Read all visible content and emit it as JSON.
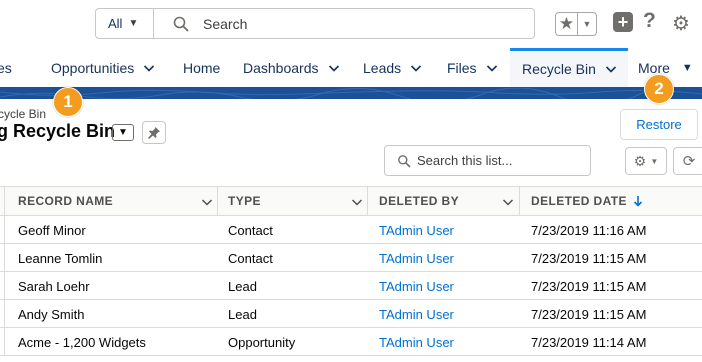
{
  "header": {
    "search_scope": "All",
    "search_placeholder": "Search"
  },
  "nav": {
    "partial_app_label": "es",
    "items": [
      {
        "label": "Opportunities",
        "has_menu": true
      },
      {
        "label": "Home",
        "has_menu": false
      },
      {
        "label": "Dashboards",
        "has_menu": true
      },
      {
        "label": "Leads",
        "has_menu": true
      },
      {
        "label": "Files",
        "has_menu": true
      },
      {
        "label": "Recycle Bin",
        "has_menu": true,
        "active": true
      },
      {
        "label": "More",
        "has_menu": true
      }
    ]
  },
  "callouts": [
    "1",
    "2"
  ],
  "list": {
    "breadcrumb": "cycle Bin",
    "title": "g Recycle Bin",
    "restore_label": "Restore",
    "search_placeholder": "Search this list..."
  },
  "table": {
    "columns": [
      "RECORD NAME",
      "TYPE",
      "DELETED BY",
      "DELETED DATE"
    ],
    "sorted_column": "DELETED DATE",
    "rows": [
      {
        "record": "Geoff Minor",
        "type": "Contact",
        "deleted_by": "TAdmin User",
        "date": "7/23/2019 11:16 AM"
      },
      {
        "record": "Leanne Tomlin",
        "type": "Contact",
        "deleted_by": "TAdmin User",
        "date": "7/23/2019 11:15 AM"
      },
      {
        "record": "Sarah Loehr",
        "type": "Lead",
        "deleted_by": "TAdmin User",
        "date": "7/23/2019 11:15 AM"
      },
      {
        "record": "Andy Smith",
        "type": "Lead",
        "deleted_by": "TAdmin User",
        "date": "7/23/2019 11:15 AM"
      },
      {
        "record": "Acme - 1,200 Widgets",
        "type": "Opportunity",
        "deleted_by": "TAdmin User",
        "date": "7/23/2019 11:14 AM"
      }
    ]
  },
  "icons": [
    "search-icon",
    "star-icon",
    "plus-icon",
    "help-icon",
    "gear-icon",
    "chevron-down-icon",
    "pin-icon",
    "refresh-icon",
    "arrow-down-icon"
  ],
  "colors": {
    "brand_band": "#1b5297",
    "accent_blue": "#0070d2",
    "active_tab_border": "#1589ee",
    "callout_orange": "#f39c1f"
  }
}
